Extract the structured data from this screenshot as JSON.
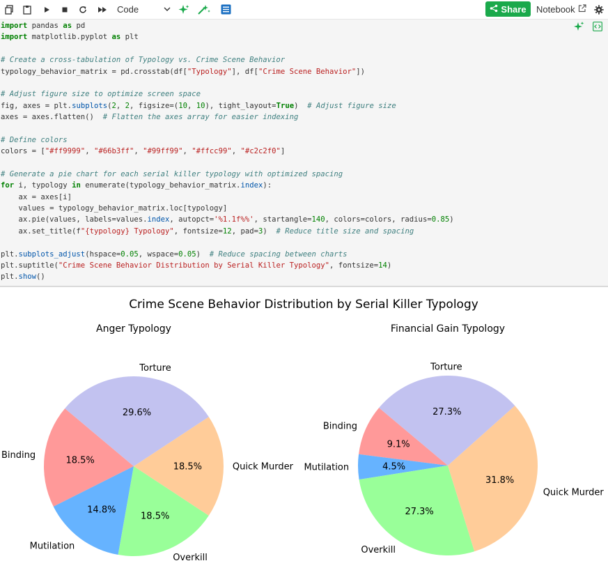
{
  "toolbar": {
    "cell_type": "Code",
    "share_label": "Share",
    "notebook_label": "Notebook",
    "icons": [
      "copy-icon",
      "paste-icon",
      "run-icon",
      "stop-icon",
      "restart-icon",
      "run-all-icon",
      "chevron-down-icon",
      "ai-sparkle-icon",
      "ai-magic-icon",
      "table-of-contents-icon",
      "share-icon",
      "external-link-icon",
      "settings-gear-icon"
    ]
  },
  "code_lines": [
    "import pandas as pd",
    "import matplotlib.pyplot as plt",
    "",
    "# Create a cross-tabulation of Typology vs. Crime Scene Behavior",
    "typology_behavior_matrix = pd.crosstab(df[\"Typology\"], df[\"Crime Scene Behavior\"])",
    "",
    "# Adjust figure size to optimize screen space",
    "fig, axes = plt.subplots(2, 2, figsize=(10, 10), tight_layout=True)  # Adjust figure size",
    "axes = axes.flatten()  # Flatten the axes array for easier indexing",
    "",
    "# Define colors",
    "colors = [\"#ff9999\", \"#66b3ff\", \"#99ff99\", \"#ffcc99\", \"#c2c2f0\"]",
    "",
    "# Generate a pie chart for each serial killer typology with optimized spacing",
    "for i, typology in enumerate(typology_behavior_matrix.index):",
    "    ax = axes[i]",
    "    values = typology_behavior_matrix.loc[typology]",
    "    ax.pie(values, labels=values.index, autopct='%1.1f%%', startangle=140, colors=colors, radius=0.85)",
    "    ax.set_title(f\"{typology} Typology\", fontsize=12, pad=3)  # Reduce title size and spacing",
    "",
    "plt.subplots_adjust(hspace=0.05, wspace=0.05)  # Reduce spacing between charts",
    "plt.suptitle(\"Crime Scene Behavior Distribution by Serial Killer Typology\", fontsize=14)",
    "plt.show()"
  ],
  "figure": {
    "suptitle": "Crime Scene Behavior Distribution by Serial Killer Typology"
  },
  "chart_data": [
    {
      "type": "pie",
      "title": "Anger Typology",
      "start_angle": 140,
      "labels": [
        "Binding",
        "Mutilation",
        "Overkill",
        "Quick Murder",
        "Torture"
      ],
      "values": [
        18.5,
        14.8,
        18.5,
        18.5,
        29.6
      ],
      "value_labels": [
        "18.5%",
        "14.8%",
        "18.5%",
        "18.5%",
        "29.6%"
      ],
      "colors": [
        "#ff9999",
        "#66b3ff",
        "#99ff99",
        "#ffcc99",
        "#c2c2f0"
      ]
    },
    {
      "type": "pie",
      "title": "Financial Gain Typology",
      "start_angle": 140,
      "labels": [
        "Binding",
        "Mutilation",
        "Overkill",
        "Quick Murder",
        "Torture"
      ],
      "values": [
        9.1,
        4.5,
        27.3,
        31.8,
        27.3
      ],
      "value_labels": [
        "9.1%",
        "4.5%",
        "27.3%",
        "31.8%",
        "27.3%"
      ],
      "colors": [
        "#ff9999",
        "#66b3ff",
        "#99ff99",
        "#ffcc99",
        "#c2c2f0"
      ]
    }
  ]
}
